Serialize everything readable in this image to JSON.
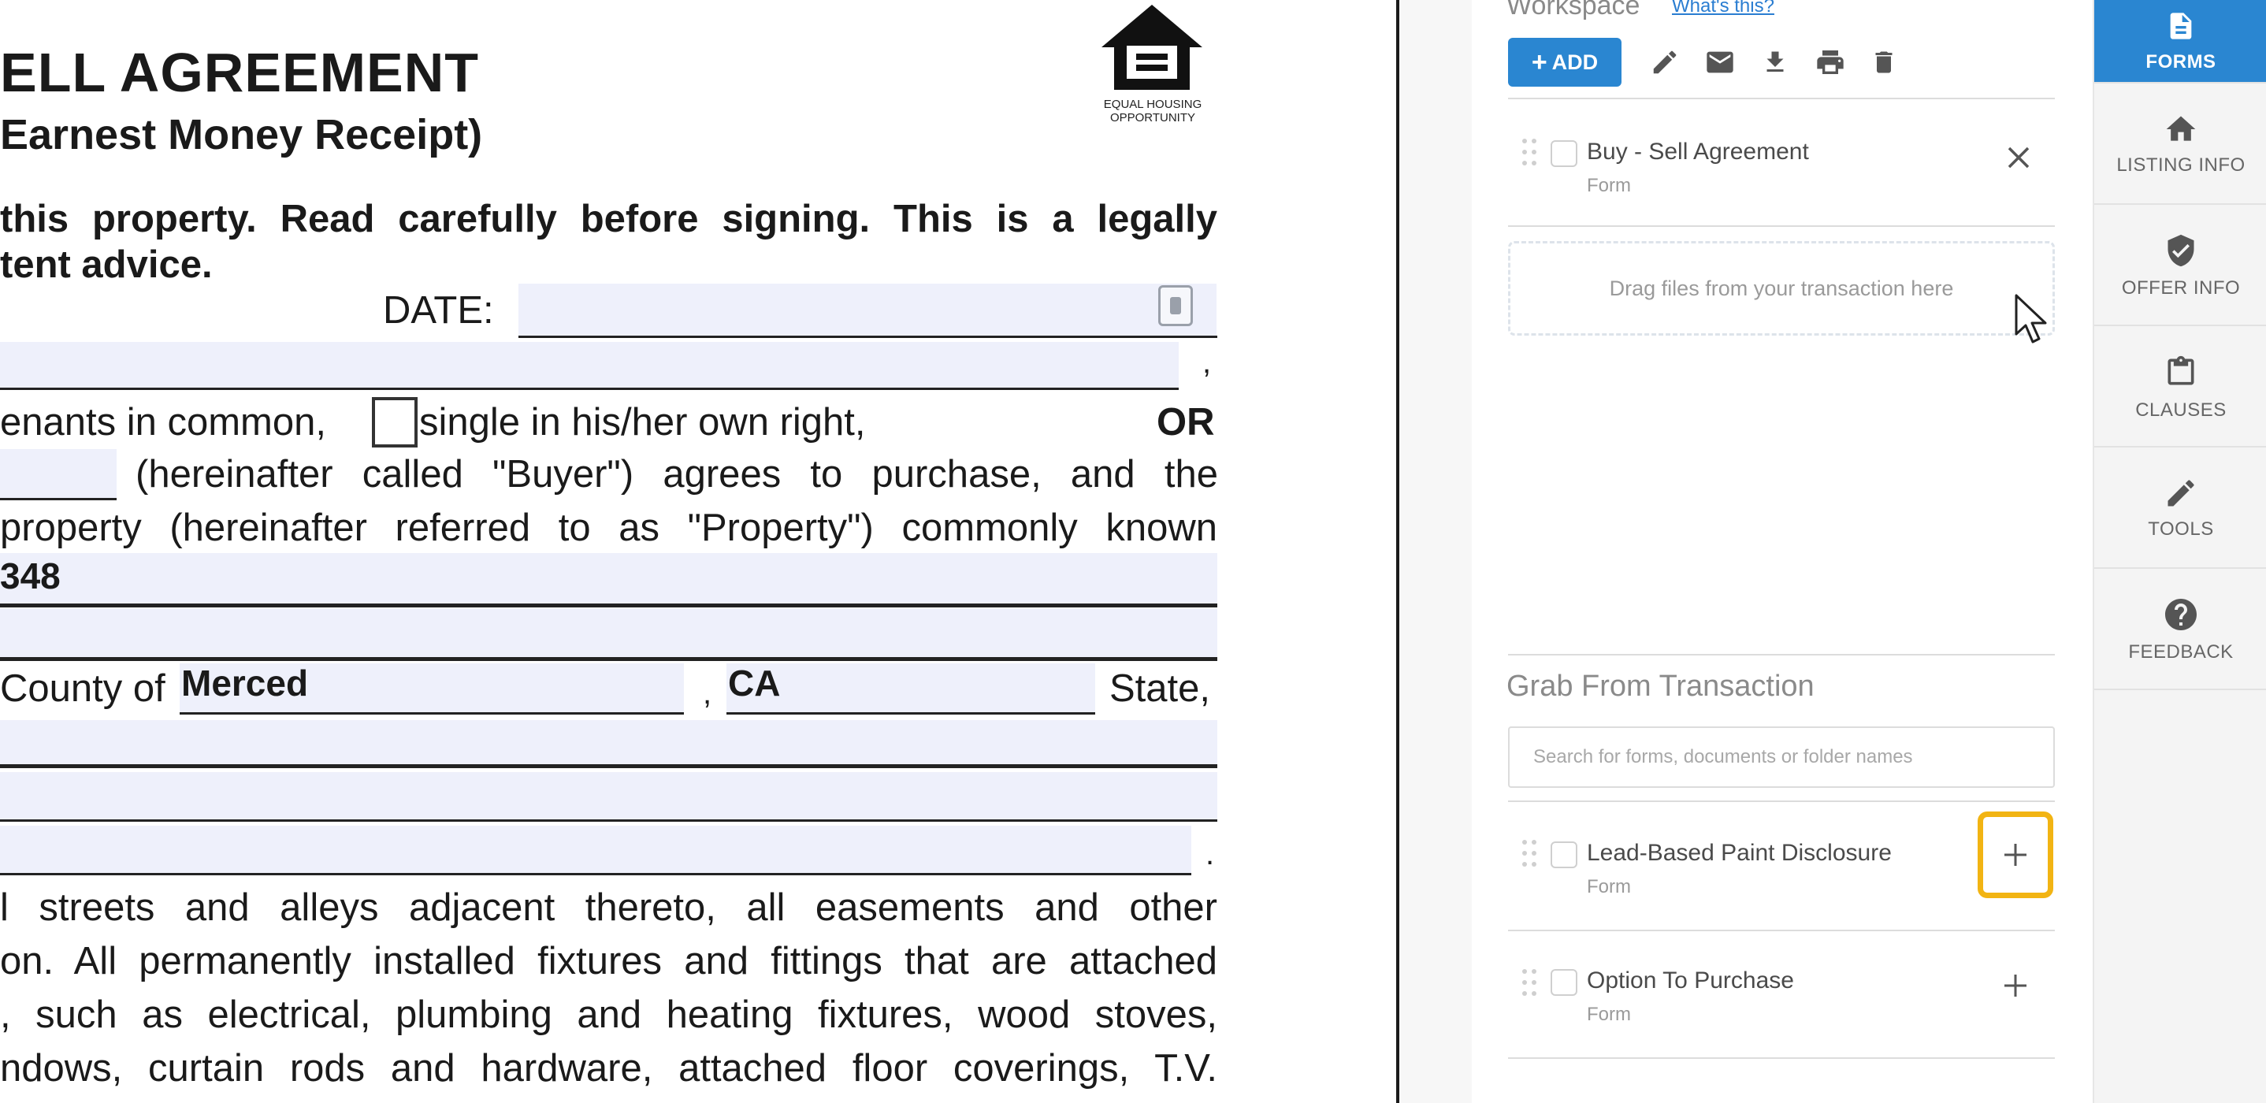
{
  "document": {
    "title_line1": "ELL AGREEMENT",
    "title_line2": "Earnest Money Receipt)",
    "eho_logo_text": "EQUAL HOUSING OPPORTUNITY",
    "warning_line1": "this property. Read carefully before signing. This is a legally",
    "warning_line2": "tent advice.",
    "date_label": "DATE:",
    "comma_mark": ",",
    "line_tenants": "enants in common,",
    "line_single": "single in his/her own right,",
    "or_label": "OR",
    "line_buyer": "(hereinafter called \"Buyer\") agrees to purchase, and the",
    "line_property": "property (hereinafter referred to as \"Property\") commonly known",
    "address_value": "348",
    "county_label": "County of",
    "county_value": "Merced",
    "state_value": "CA",
    "state_label": "State,",
    "period_mark": ".",
    "para1": "l streets and alleys adjacent thereto, all easements and other",
    "para2": "on. All permanently installed fixtures and fittings that are attached",
    "para3": ", such as electrical, plumbing and heating fixtures, wood stoves,",
    "para4": "ndows, curtain rods and hardware, attached floor coverings, T.V."
  },
  "workspace": {
    "title": "Workspace",
    "help_link": "What's this?",
    "add_button": "ADD",
    "toolbar_icons": [
      "pencil-icon",
      "mail-icon",
      "download-icon",
      "print-icon",
      "trash-icon"
    ],
    "items": [
      {
        "title": "Buy - Sell Agreement",
        "type": "Form"
      }
    ],
    "dropzone_text": "Drag files from your transaction here"
  },
  "grab": {
    "title": "Grab From Transaction",
    "search_placeholder": "Search for forms, documents or folder names",
    "items": [
      {
        "title": "Lead-Based Paint Disclosure",
        "type": "Form"
      },
      {
        "title": "Option To Purchase",
        "type": "Form"
      }
    ]
  },
  "nav": {
    "items": [
      {
        "label": "FORMS",
        "icon": "document-icon",
        "active": true
      },
      {
        "label": "LISTING INFO",
        "icon": "home-icon",
        "active": false
      },
      {
        "label": "OFFER INFO",
        "icon": "shield-check-icon",
        "active": false
      },
      {
        "label": "CLAUSES",
        "icon": "clipboard-icon",
        "active": false
      },
      {
        "label": "TOOLS",
        "icon": "pencil-icon",
        "active": false
      },
      {
        "label": "FEEDBACK",
        "icon": "help-icon",
        "active": false
      }
    ]
  },
  "colors": {
    "accent": "#2a86d1",
    "highlight": "#f2b413",
    "field_fill": "#eef0fb"
  }
}
